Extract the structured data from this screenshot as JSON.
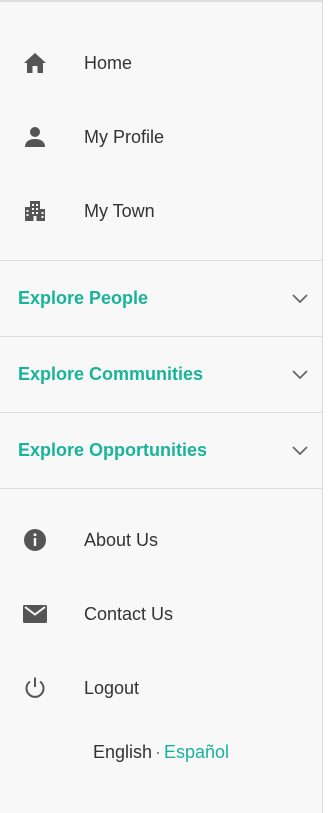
{
  "nav": {
    "home": "Home",
    "profile": "My Profile",
    "town": "My Town"
  },
  "explore": {
    "people": "Explore People",
    "communities": "Explore Communities",
    "opportunities": "Explore Opportunities"
  },
  "bottom": {
    "about": "About Us",
    "contact": "Contact Us",
    "logout": "Logout"
  },
  "language": {
    "english": "English",
    "separator": "·",
    "spanish": "Español"
  },
  "colors": {
    "accent": "#19b39b",
    "icon": "#555555",
    "text": "#333333"
  },
  "icons": {
    "home": "home-icon",
    "profile": "person-icon",
    "town": "city-icon",
    "about": "info-icon",
    "contact": "mail-icon",
    "logout": "power-icon",
    "chevron": "chevron-down-icon"
  }
}
